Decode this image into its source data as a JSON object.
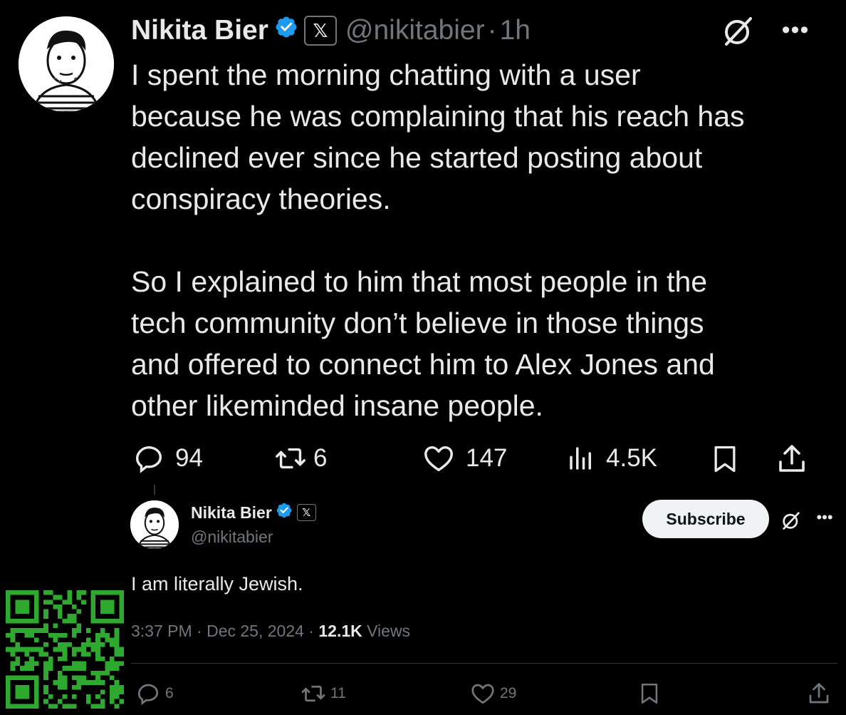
{
  "main_tweet": {
    "author_name": "Nikita Bier",
    "x_badge": "𝕏",
    "handle": "@nikitabier",
    "separator": "·",
    "time": "1h",
    "more": "•••",
    "text": "I spent the morning chatting with a user\nbecause he was complaining that his reach has\ndeclined ever since he started posting about\nconspiracy theories.\n\nSo I explained to him that most people in the\ntech community don’t believe in those things\nand offered to connect him to Alex Jones and\nother likeminded insane people.",
    "actions": {
      "replies": "94",
      "reposts": "6",
      "likes": "147",
      "views": "4.5K"
    }
  },
  "reply_tweet": {
    "author_name": "Nikita Bier",
    "x_badge": "𝕏",
    "handle": "@nikitabier",
    "subscribe_label": "Subscribe",
    "more": "•••",
    "text": "I am literally Jewish.",
    "timestamp": "3:37 PM · Dec 25, 2024 · ",
    "views_count": "12.1K",
    "views_label": " Views",
    "actions": {
      "replies": "6",
      "reposts": "11",
      "likes": "29"
    }
  },
  "colors": {
    "background": "#000000",
    "text": "#e7e9ea",
    "muted": "#71767b",
    "verified": "#1d9bf0",
    "qr": "#2ea82e"
  },
  "icons": [
    "verified-badge-icon",
    "x-logo-icon",
    "grok-icon",
    "reply-icon",
    "repost-icon",
    "like-icon",
    "views-icon",
    "bookmark-icon",
    "share-icon"
  ]
}
